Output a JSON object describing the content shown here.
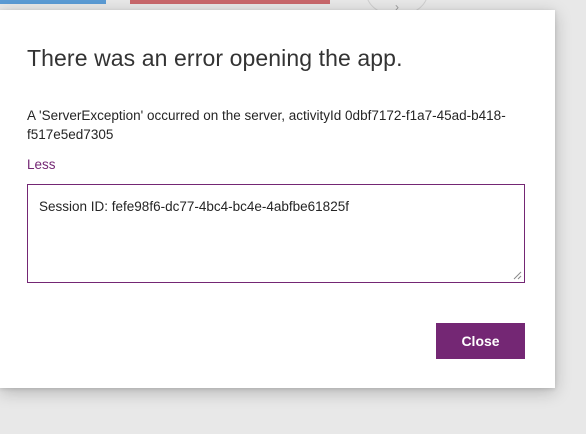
{
  "background": {
    "partial_icon": "chevron-right-icon",
    "partial_glyph": "›"
  },
  "dialog": {
    "title": "There was an error opening the app.",
    "message": "A 'ServerException' occurred on the server, activityId 0dbf7172-f1a7-45ad-b418-f517e5ed7305",
    "toggle_label": "Less",
    "details_text": "Session ID: fefe98f6-dc77-4bc4-bc4e-4abfbe61825f",
    "close_label": "Close"
  },
  "colors": {
    "accent": "#742774",
    "title_text": "#333333",
    "body_text": "#252525",
    "backdrop": "#e8e8e8"
  }
}
